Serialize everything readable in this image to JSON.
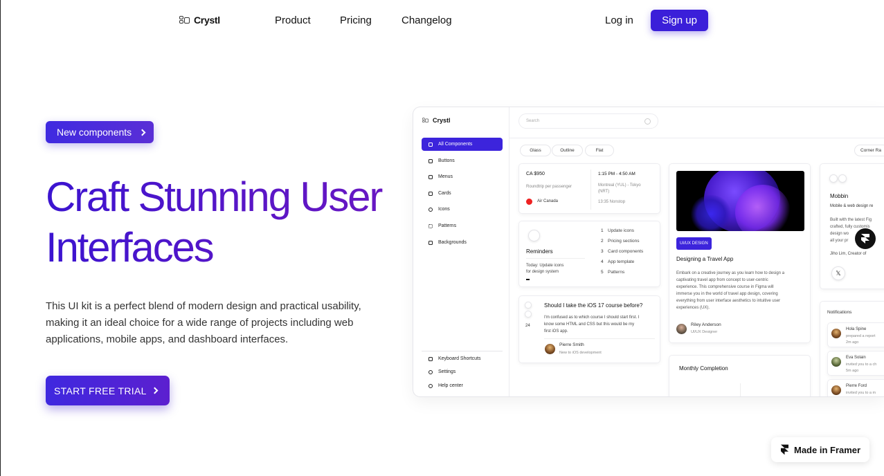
{
  "nav": {
    "logo": "Crystl",
    "links": [
      "Product",
      "Pricing",
      "Changelog"
    ],
    "login": "Log in",
    "signup": "Sign up"
  },
  "hero": {
    "badge": "New components",
    "headline_line1": "Craft Stunning User",
    "headline_line2": "Interfaces",
    "description": "This UI kit is a perfect blend of modern design and practical usability, making it an ideal choice for a wide range of projects including web applications, mobile apps, and dashboard interfaces.",
    "cta": "START FREE TRIAL"
  },
  "preview": {
    "logo": "Crystl",
    "sidebar": [
      "All Components",
      "Buttons",
      "Menus",
      "Cards",
      "Icons",
      "Patterns",
      "Backgrounds"
    ],
    "sidebar_bottom": [
      "Keyboard Shortcuts",
      "Settings",
      "Help center"
    ],
    "search_placeholder": "Search",
    "chips": [
      "Glass",
      "Outline",
      "Flat",
      "Corner Ra"
    ],
    "flight": {
      "price": "CA $950",
      "type": "Roundtrip per passenger",
      "airline": "Air Canada",
      "time": "1:15 PM - 4:50 AM",
      "route_line1": "Montreal (YUL) - Tokyo",
      "route_line2": "(NRT)",
      "duration": "13:35 Nonstop"
    },
    "reminders": {
      "title": "Reminders",
      "note_line1": "Today: Update icons",
      "note_line2": "for design system",
      "items": [
        {
          "n": "1",
          "label": "Update icons"
        },
        {
          "n": "2",
          "label": "Pricing sections"
        },
        {
          "n": "3",
          "label": "Card components"
        },
        {
          "n": "4",
          "label": "App template"
        },
        {
          "n": "5",
          "label": "Patterns"
        }
      ]
    },
    "question": {
      "votes": "24",
      "title": "Should I take the iOS 17 course before?",
      "body_line1": "I'm confused as to which course I should start first. I",
      "body_line2": "know some HTML and CSS but this would be my",
      "body_line3": "first iOS app.",
      "author": "Pierre Smith",
      "author_role": "New to iOS development"
    },
    "course": {
      "tag": "UI/UX DESIGN",
      "title": "Designing a Travel App",
      "body_lines": [
        "Embark on a creative journey as you learn how to design a",
        "captivating travel app from concept to user-centric",
        "experience. This comprehensive course in Figma will",
        "immerse you in the world of travel app design, covering",
        "everything from user interface aesthetics to intuitive user",
        "experiences (UX)."
      ],
      "author": "Riley Anderson",
      "author_role": "UI/UX Designer"
    },
    "monthly": "Monthly Completion",
    "mobbin": {
      "title": "Mobbin",
      "subtitle": "Mobile & web design re",
      "body_lines": [
        "Built with the latest Fig",
        "crafted, fully customis",
        "design wo",
        "all your pr"
      ],
      "author": "Jiho Lim, Creator of",
      "x_icon": "𝕏"
    },
    "notifications": {
      "title": "Notifications",
      "items": [
        {
          "name": "Hola Spine",
          "text": "prepared a report",
          "time": "2m ago"
        },
        {
          "name": "Eva Solain",
          "text": "invited you to a ch",
          "time": "5m ago"
        },
        {
          "name": "Pierre Ford",
          "text": "invited you to a m",
          "time": ""
        }
      ]
    }
  },
  "framer_badge": "Made in Framer"
}
